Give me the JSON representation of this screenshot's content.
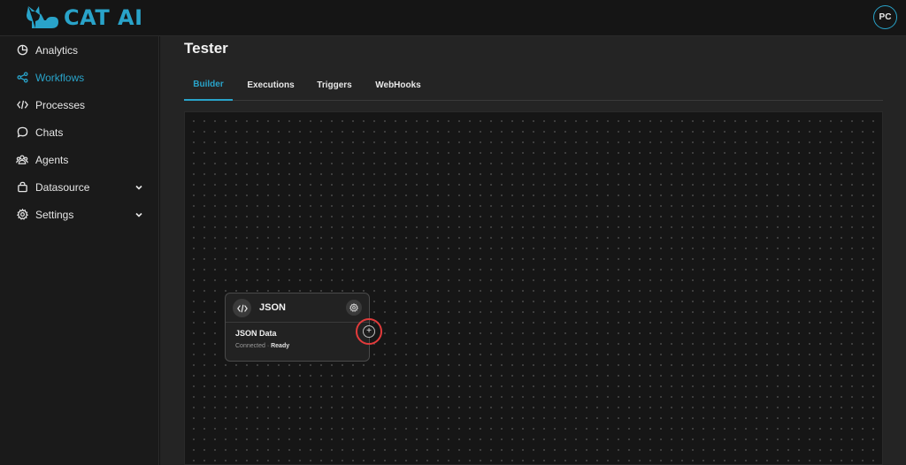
{
  "brand": {
    "name": "CAT AI",
    "accent": "#29a3c9",
    "logo_icon": "cat-icon"
  },
  "user": {
    "initials": "PC"
  },
  "sidebar": {
    "items": [
      {
        "label": "Analytics",
        "icon": "pie-chart-icon",
        "active": false,
        "has_chevron": false
      },
      {
        "label": "Workflows",
        "icon": "share-nodes-icon",
        "active": true,
        "has_chevron": false
      },
      {
        "label": "Processes",
        "icon": "code-icon",
        "active": false,
        "has_chevron": false
      },
      {
        "label": "Chats",
        "icon": "chat-bubble-icon",
        "active": false,
        "has_chevron": false
      },
      {
        "label": "Agents",
        "icon": "users-icon",
        "active": false,
        "has_chevron": false
      },
      {
        "label": "Datasource",
        "icon": "bag-icon",
        "active": false,
        "has_chevron": true
      },
      {
        "label": "Settings",
        "icon": "gear-icon",
        "active": false,
        "has_chevron": true
      }
    ]
  },
  "page": {
    "title": "Tester"
  },
  "tabs": [
    {
      "label": "Builder",
      "active": true
    },
    {
      "label": "Executions",
      "active": false
    },
    {
      "label": "Triggers",
      "active": false
    },
    {
      "label": "WebHooks",
      "active": false
    }
  ],
  "node": {
    "title": "JSON",
    "subtitle": "JSON Data",
    "status_left": "Connected",
    "status_sep": "·",
    "status_right": "Ready",
    "icon": "code-icon",
    "settings_icon": "gear-icon",
    "add_icon": "plus-icon",
    "highlight_color": "#e23b3b"
  }
}
